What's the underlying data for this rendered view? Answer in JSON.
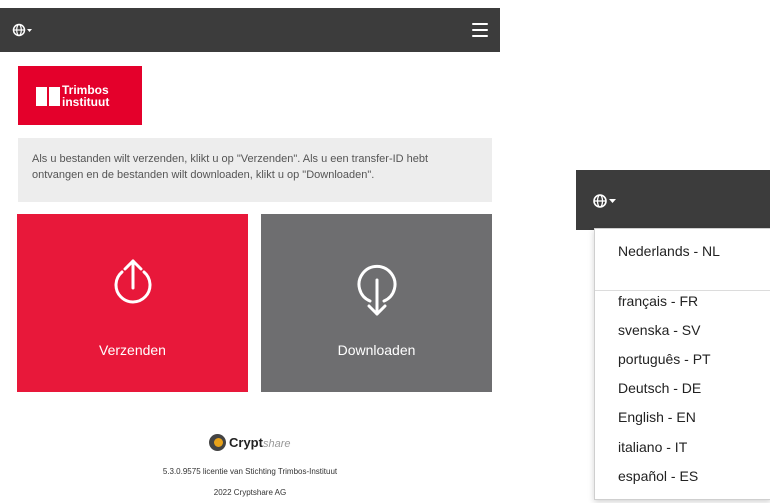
{
  "header": {
    "language_icon": "globe-icon",
    "menu_icon": "hamburger-menu-icon"
  },
  "logo": {
    "line1": "Trimbos",
    "line2": "instituut"
  },
  "info_text": "Als u bestanden wilt verzenden, klikt u op \"Verzenden\". Als u een transfer-ID hebt ontvangen en de bestanden wilt downloaden, klikt u op \"Downloaden\".",
  "tiles": {
    "send": {
      "label": "Verzenden",
      "icon": "upload-arrow-icon"
    },
    "download": {
      "label": "Downloaden",
      "icon": "download-arrow-icon"
    }
  },
  "footer": {
    "brand": "Crypt",
    "brand_suffix": "share",
    "license": "5.3.0.9575 licentie van Stichting Trimbos-Instituut",
    "copyright": "2022 Cryptshare AG"
  },
  "language_menu": {
    "selected": "Nederlands - NL",
    "options": [
      "français - FR",
      "svenska - SV",
      "português - PT",
      "Deutsch - DE",
      "English - EN",
      "italiano - IT",
      "español - ES"
    ]
  },
  "colors": {
    "brand_red": "#e4002b",
    "tile_red": "#e8183a",
    "tile_grey": "#6e6e70",
    "topbar": "#3c3c3c"
  }
}
